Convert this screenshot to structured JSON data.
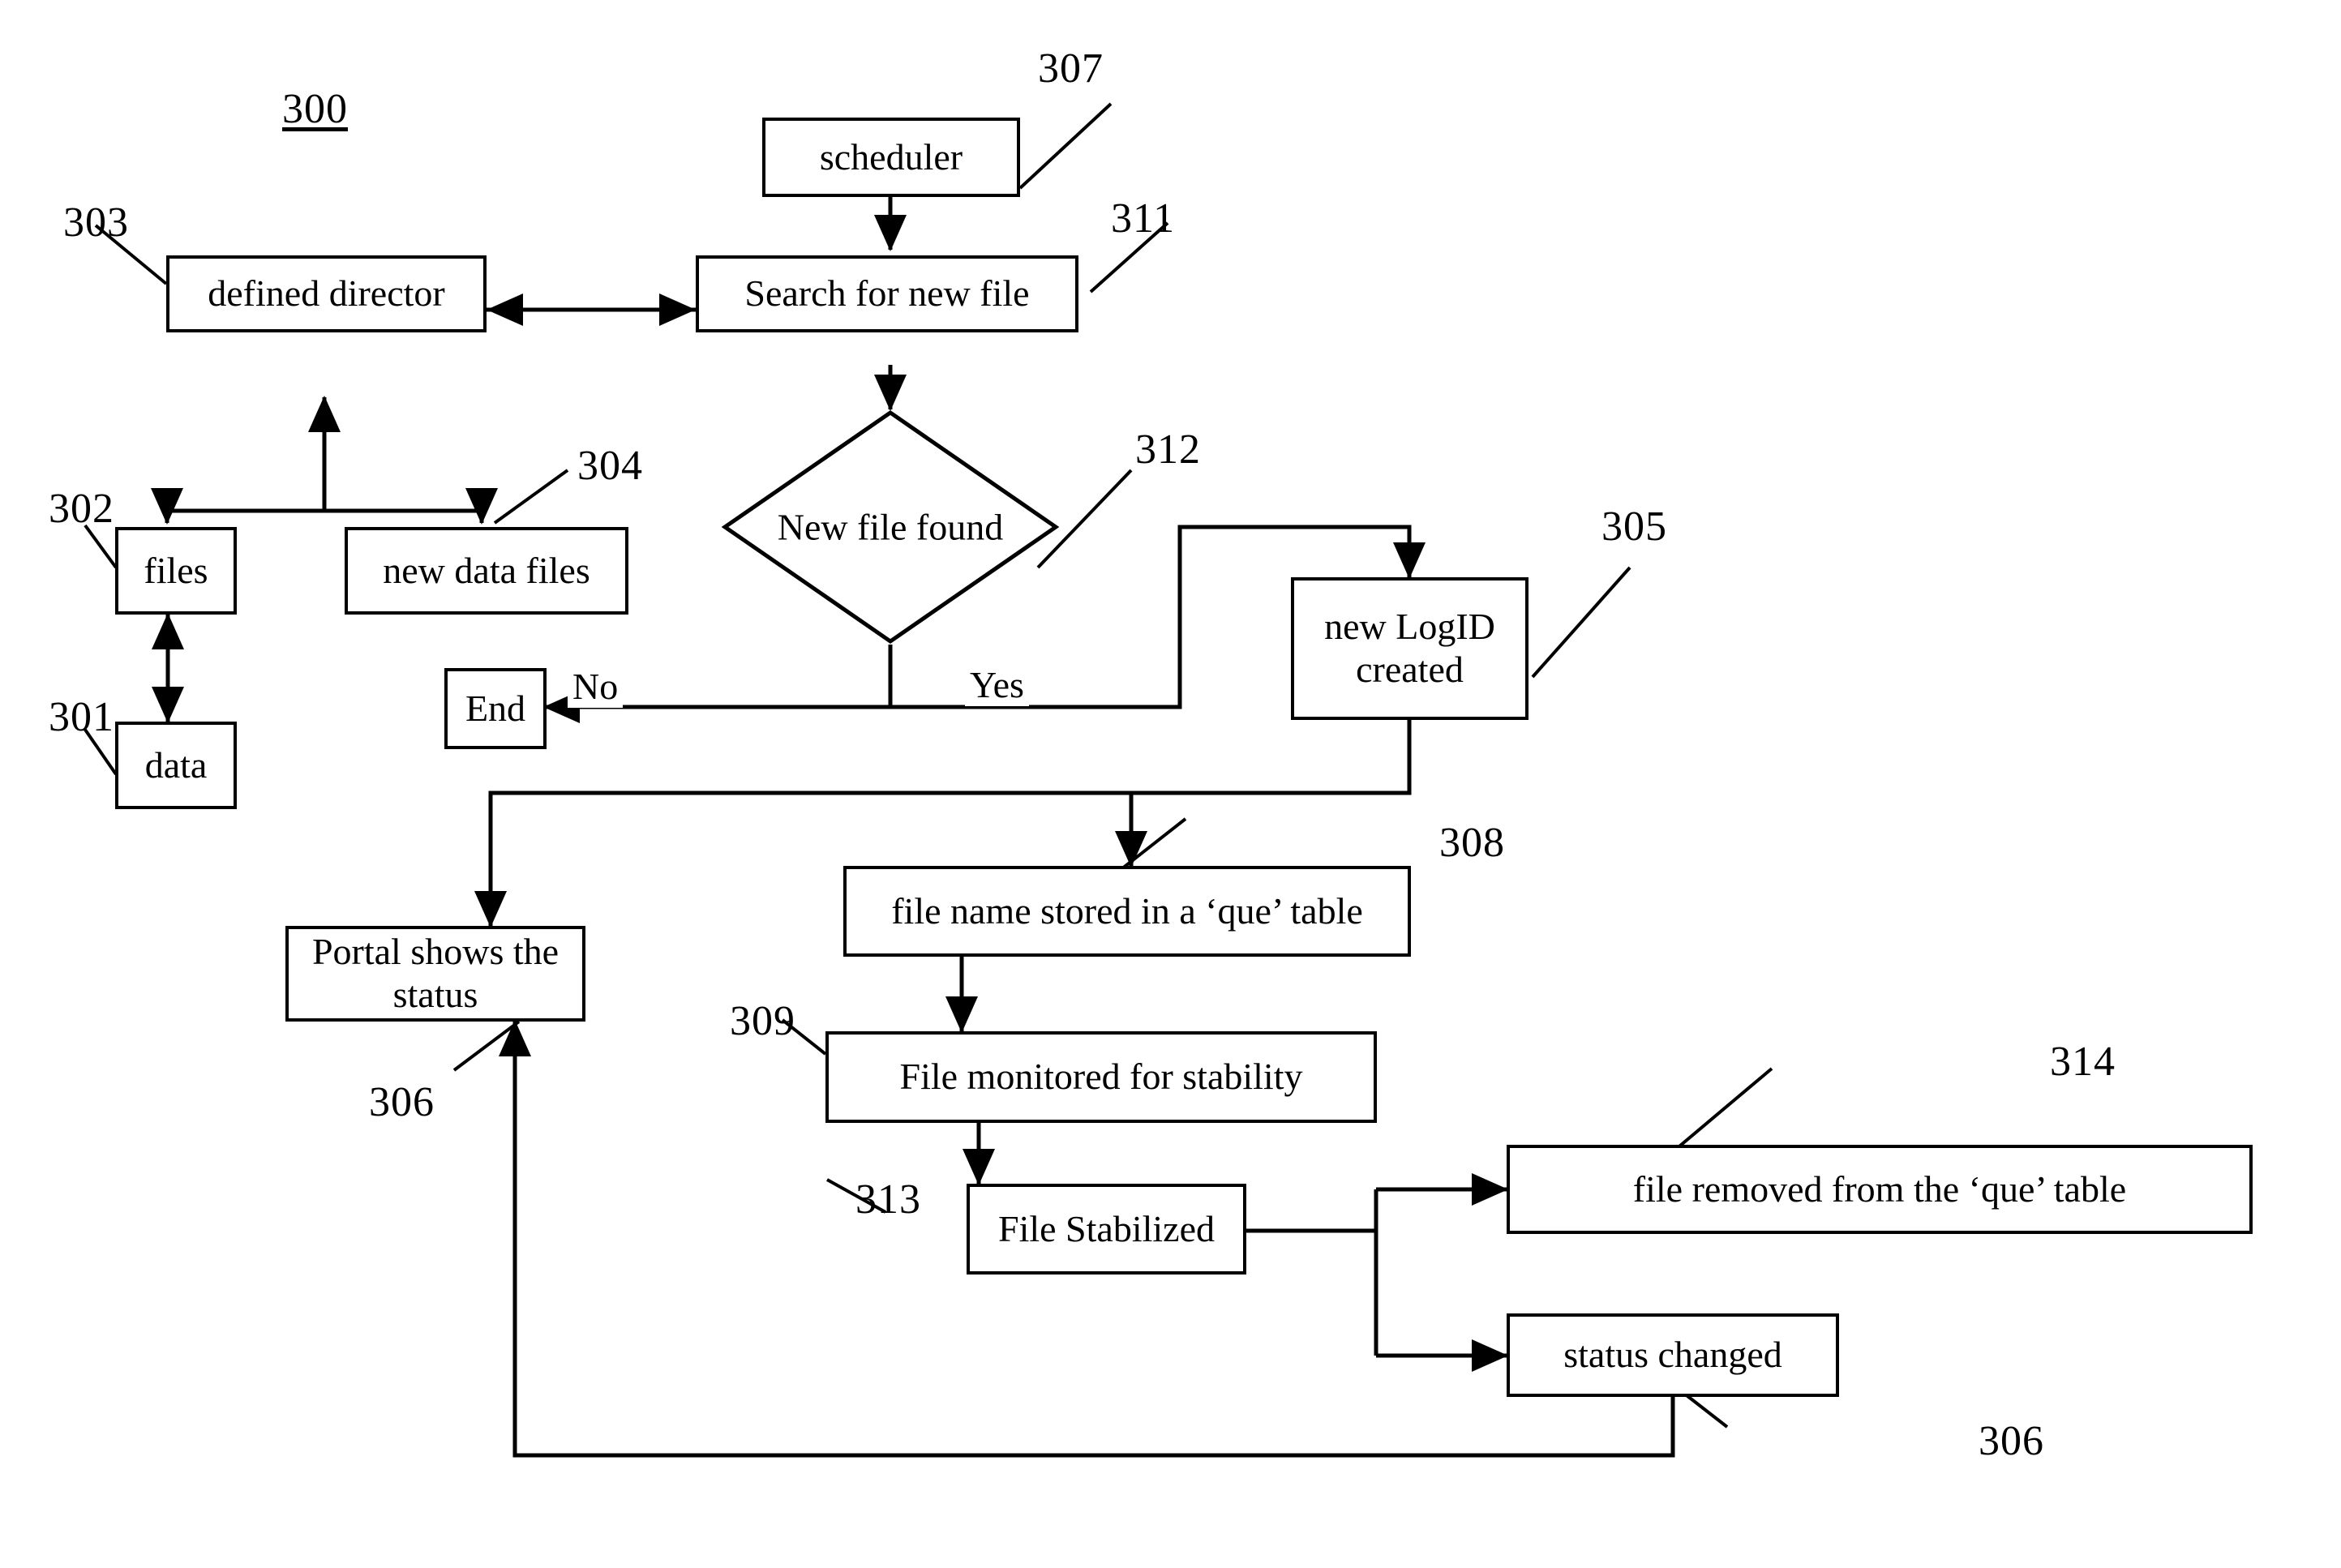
{
  "figure": {
    "number": "300",
    "type": "flowchart",
    "title": ""
  },
  "nodes": [
    {
      "id": "scheduler",
      "label": "scheduler",
      "ref": "307",
      "shape": "rect"
    },
    {
      "id": "defined-director",
      "label": "defined director",
      "ref": "303",
      "shape": "rect"
    },
    {
      "id": "search-new-file",
      "label": "Search for new file",
      "ref": "311",
      "shape": "rect"
    },
    {
      "id": "files",
      "label": "files",
      "ref": "302",
      "shape": "rect"
    },
    {
      "id": "new-data-files",
      "label": "new data files",
      "ref": "304",
      "shape": "rect"
    },
    {
      "id": "data",
      "label": "data",
      "ref": "301",
      "shape": "rect"
    },
    {
      "id": "new-file-found",
      "label": "New file found",
      "ref": "312",
      "shape": "diamond"
    },
    {
      "id": "end",
      "label": "End",
      "ref": "",
      "shape": "rect"
    },
    {
      "id": "new-logid",
      "label": "new LogID\ncreated",
      "ref": "305",
      "shape": "rect"
    },
    {
      "id": "portal-status",
      "label": "Portal shows the status",
      "ref": "306",
      "shape": "rect"
    },
    {
      "id": "que-stored",
      "label": "file name stored in a ‘que’ table",
      "ref": "308",
      "shape": "rect"
    },
    {
      "id": "file-monitored",
      "label": "File monitored for stability",
      "ref": "309",
      "shape": "rect"
    },
    {
      "id": "file-stabilized",
      "label": "File Stabilized",
      "ref": "313",
      "shape": "rect"
    },
    {
      "id": "file-removed",
      "label": "file removed from the ‘que’ table",
      "ref": "314",
      "shape": "rect"
    },
    {
      "id": "status-changed",
      "label": "status changed",
      "ref": "306",
      "shape": "rect"
    }
  ],
  "labels": {
    "figure_number": "300",
    "scheduler": "scheduler",
    "defined_director": "defined director",
    "search_new_file": "Search for new file",
    "files": "files",
    "new_data_files": "new data files",
    "data": "data",
    "new_file_found": "New file found",
    "end": "End",
    "new_logid": "new LogID\ncreated",
    "portal_status": "Portal shows the status",
    "que_stored": "file name stored in a ‘que’ table",
    "file_monitored": "File monitored for stability",
    "file_stabilized": "File Stabilized",
    "file_removed": "file removed from the ‘que’ table",
    "status_changed": "status changed",
    "yes": "Yes",
    "no": "No"
  },
  "refs": {
    "r300": "300",
    "r301": "301",
    "r302": "302",
    "r303": "303",
    "r304": "304",
    "r305": "305",
    "r306_portal": "306",
    "r306_status": "306",
    "r307": "307",
    "r308": "308",
    "r309": "309",
    "r311": "311",
    "r312": "312",
    "r313": "313",
    "r314": "314"
  },
  "colors": {
    "stroke": "#000000",
    "fill": "#ffffff",
    "text": "#000000"
  }
}
